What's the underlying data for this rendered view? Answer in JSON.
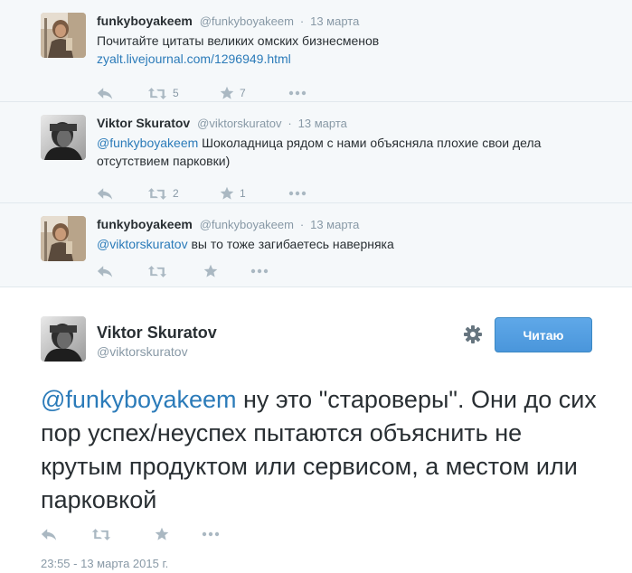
{
  "thread": [
    {
      "fullname": "funkyboyakeem",
      "username": "@funkyboyakeem",
      "time": "13 марта",
      "text": "Почитайте цитаты великих омских бизнесменов ",
      "link": "zyalt.livejournal.com/1296949.html",
      "retweets": "5",
      "favorites": "7"
    },
    {
      "fullname": "Viktor Skuratov",
      "username": "@viktorskuratov",
      "time": "13 марта",
      "mention": "@funkyboyakeem",
      "text": " Шоколадница рядом с нами объясняла плохие свои дела отсутствием парковки)",
      "retweets": "2",
      "favorites": "1"
    },
    {
      "fullname": "funkyboyakeem",
      "username": "@funkyboyakeem",
      "time": "13 марта",
      "mention": "@viktorskuratov",
      "text": " вы то тоже загибаетесь наверняка"
    }
  ],
  "main_tweet": {
    "fullname": "Viktor Skuratov",
    "username": "@viktorskuratov",
    "follow_label": "Читаю",
    "mention": "@funkyboyakeem",
    "text": " ну это \"староверы\". Они до сих пор успех/неуспех пытаются объяснить не крутым продуктом или сервисом, а местом или парковкой",
    "timestamp": "23:55 - 13 марта 2015 г."
  },
  "separator": "·",
  "icons": {
    "reply": "reply-icon",
    "retweet": "retweet-icon",
    "favorite": "star-icon",
    "more": "more-icon",
    "settings": "gear-icon"
  },
  "colors": {
    "link": "#2b7bb9",
    "button": "#4a96db",
    "muted": "#8899a6",
    "thread_bg": "#f5f8fa"
  }
}
